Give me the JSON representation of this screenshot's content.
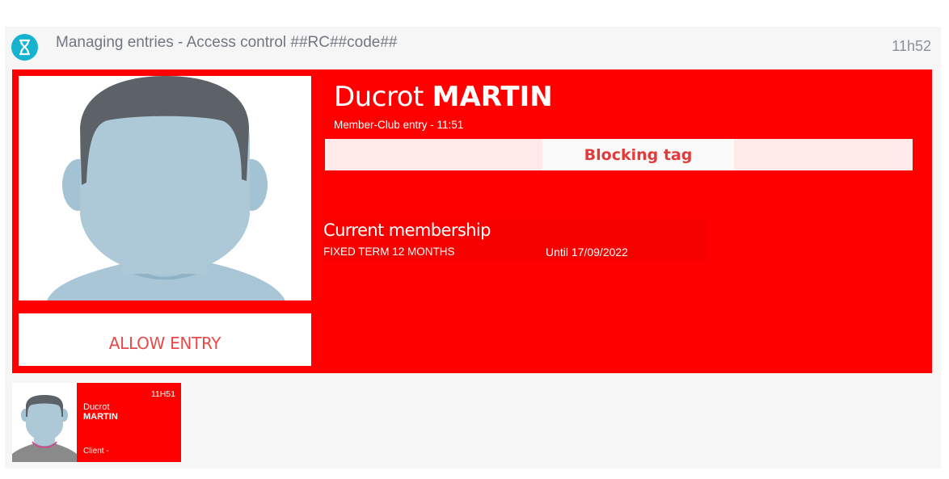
{
  "header": {
    "title": "Managing entries - Access control ##RC##code##",
    "clock": "11h52",
    "logo_icon": "hourglass-logo-icon"
  },
  "current_entry": {
    "first_name": "Ducrot",
    "last_name": "MARTIN",
    "entry_info": "Member-Club entry - 11:51",
    "alert": "Blocking tag",
    "allow_button": "ALLOW ENTRY",
    "membership": {
      "title": "Current membership",
      "name": "FIXED TERM 12 MONTHS",
      "until": "Until 17/09/2022"
    }
  },
  "history": [
    {
      "time": "11H51",
      "first_name": "Ducrot",
      "last_name": "MARTIN",
      "type": "Client -"
    }
  ],
  "colors": {
    "alert_red": "#ff0000",
    "accent_teal": "#15b3cf",
    "button_text": "#e84a4a"
  }
}
